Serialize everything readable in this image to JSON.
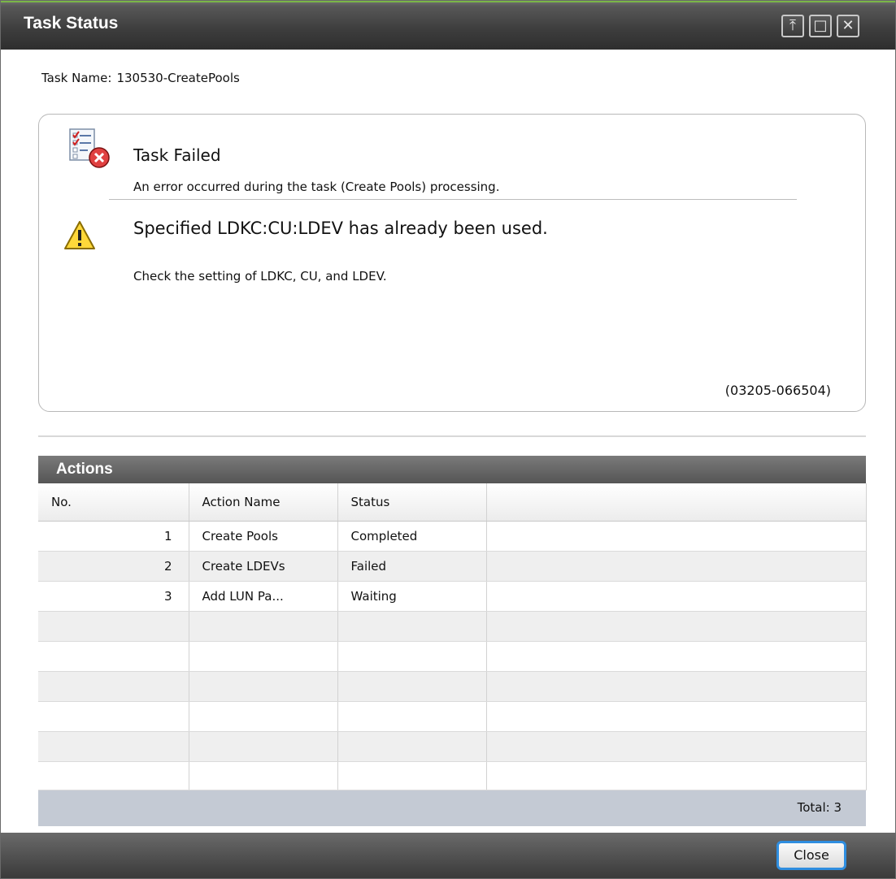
{
  "window": {
    "title": "Task Status",
    "controls": {
      "pin": "⤒",
      "maximize": "□",
      "close": "✕"
    }
  },
  "task": {
    "label": "Task Name:",
    "value": "130530-CreatePools"
  },
  "message": {
    "title": "Task Failed",
    "subtitle": "An error occurred during the task (Create Pools) processing.",
    "error": "Specified LDKC:CU:LDEV has already been used.",
    "detail": "Check the setting of LDKC, CU, and LDEV.",
    "code": "(03205-066504)",
    "icons": {
      "task": "task-failed-icon",
      "warning": "warning-icon"
    }
  },
  "actions": {
    "title": "Actions",
    "columns": [
      "No.",
      "Action Name",
      "Status",
      ""
    ],
    "rows": [
      {
        "no": "1",
        "name": "Create Pools",
        "status": "Completed"
      },
      {
        "no": "2",
        "name": "Create LDEVs",
        "status": "Failed"
      },
      {
        "no": "3",
        "name": "Add LUN Pa...",
        "status": "Waiting"
      }
    ],
    "total": "Total:  3"
  },
  "footer": {
    "close_label": "Close"
  },
  "colors": {
    "accent": "#7ab648",
    "focus": "#2f8ee0",
    "header": "#3e3e3e"
  }
}
